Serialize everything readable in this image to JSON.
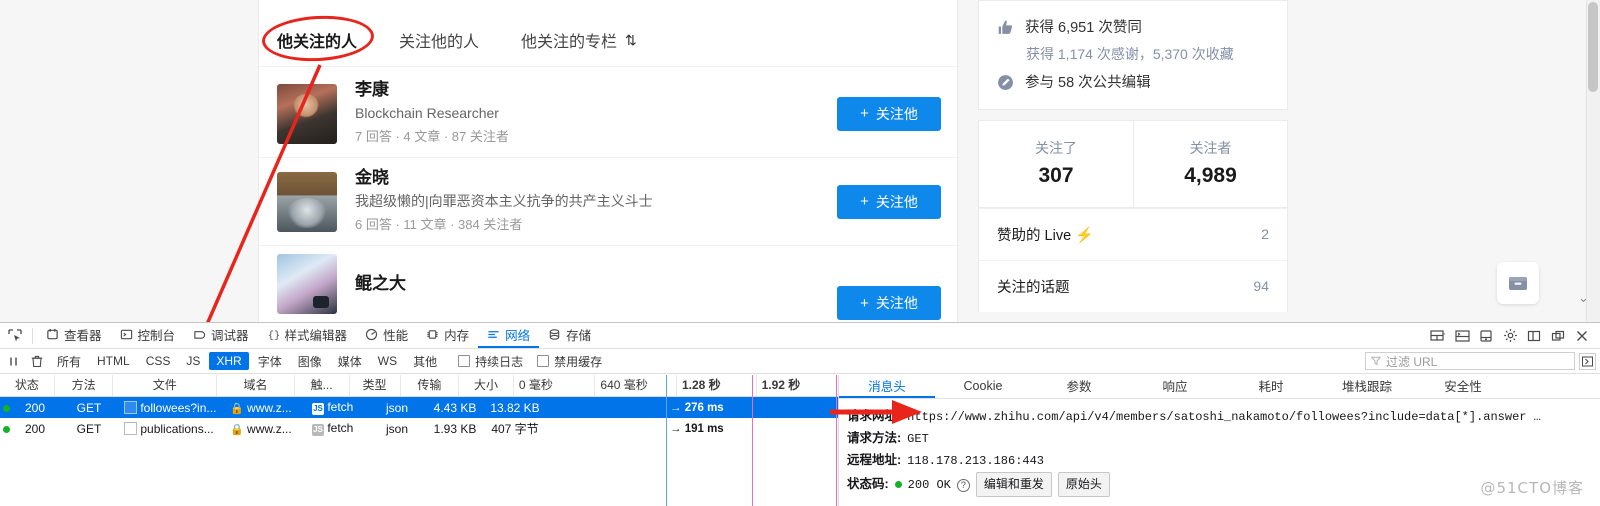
{
  "page": {
    "tabs": [
      {
        "label": "他关注的人",
        "active": true
      },
      {
        "label": "关注他的人",
        "active": false
      },
      {
        "label": "他关注的专栏",
        "active": false
      }
    ],
    "sort_glyph": "⇅",
    "users": [
      {
        "name": "李康",
        "bio": "Blockchain Researcher",
        "meta": "7 回答 · 4 文章 · 87 关注者",
        "follow_label": "关注他",
        "plus": "+"
      },
      {
        "name": "金晓",
        "bio": "我超级懒的|向罪恶资本主义抗争的共产主义斗士",
        "meta": "6 回答 · 11 文章 · 384 关注者",
        "follow_label": "关注他",
        "plus": "+"
      },
      {
        "name": "鲲之大",
        "bio": "",
        "meta": "",
        "follow_label": "关注他",
        "plus": "+"
      }
    ],
    "sidebar": {
      "votes_text": "获得 6,951 次赞同",
      "thanks_text": "获得 1,174 次感谢，5,370 次收藏",
      "edits_text": "参与 58 次公共编辑",
      "counts": [
        {
          "label": "关注了",
          "value": "307"
        },
        {
          "label": "关注者",
          "value": "4,989"
        }
      ],
      "rows": [
        {
          "label": "赞助的 Live",
          "value": "2",
          "bolt": "⚡"
        },
        {
          "label": "关注的话题",
          "value": "94",
          "bolt": ""
        }
      ]
    }
  },
  "devtools": {
    "toolbar_tabs": [
      {
        "label": "查看器",
        "active": false
      },
      {
        "label": "控制台",
        "active": false
      },
      {
        "label": "调试器",
        "active": false
      },
      {
        "label": "样式编辑器",
        "active": false
      },
      {
        "label": "性能",
        "active": false
      },
      {
        "label": "内存",
        "active": false
      },
      {
        "label": "网络",
        "active": true
      },
      {
        "label": "存储",
        "active": false
      }
    ],
    "filters": [
      {
        "label": "所有",
        "on": false
      },
      {
        "label": "HTML",
        "on": false
      },
      {
        "label": "CSS",
        "on": false
      },
      {
        "label": "JS",
        "on": false
      },
      {
        "label": "XHR",
        "on": true
      },
      {
        "label": "字体",
        "on": false
      },
      {
        "label": "图像",
        "on": false
      },
      {
        "label": "媒体",
        "on": false
      },
      {
        "label": "WS",
        "on": false
      },
      {
        "label": "其他",
        "on": false
      }
    ],
    "checkboxes": [
      {
        "label": "持续日志",
        "checked": false
      },
      {
        "label": "禁用缓存",
        "checked": false
      }
    ],
    "filter_url_placeholder": "过滤 URL",
    "filter_icon": "funnel-icon",
    "columns": [
      "状态",
      "方法",
      "文件",
      "域名",
      "触...",
      "类型",
      "传输",
      "大小"
    ],
    "timeline_ticks": [
      "0 毫秒",
      "640 毫秒",
      "1.28 秒",
      "1.92 秒"
    ],
    "rows": [
      {
        "status": "200",
        "method": "GET",
        "file": "followees?in...",
        "domain": "www.z...",
        "cause": "fetch",
        "type": "json",
        "transferred": "4.43 KB",
        "size": "13.82 KB",
        "timing": "→ 276 ms",
        "selected": true
      },
      {
        "status": "200",
        "method": "GET",
        "file": "publications...",
        "domain": "www.z...",
        "cause": "fetch",
        "type": "json",
        "transferred": "1.93 KB",
        "size": "407 字节",
        "timing": "→ 191 ms",
        "selected": false
      }
    ],
    "detail_tabs": [
      {
        "label": "消息头",
        "active": true
      },
      {
        "label": "Cookie",
        "active": false
      },
      {
        "label": "参数",
        "active": false
      },
      {
        "label": "响应",
        "active": false
      },
      {
        "label": "耗时",
        "active": false
      },
      {
        "label": "堆栈跟踪",
        "active": false
      },
      {
        "label": "安全性",
        "active": false
      }
    ],
    "detail": {
      "url_key": "请求网址:",
      "url_value": "https://www.zhihu.com/api/v4/members/satoshi_nakamoto/followees?include=data[*].answer …",
      "method_key": "请求方法:",
      "method_value": "GET",
      "remote_key": "远程地址:",
      "remote_value": "118.178.213.186:443",
      "status_key": "状态码:",
      "status_value": "200 OK",
      "btn_resend": "编辑和重发",
      "btn_raw": "原始头"
    }
  },
  "watermark": "@51CTO博客",
  "colors": {
    "accent_blue": "#0f88eb",
    "devtools_blue": "#0074e8",
    "annotation_red": "#e8251c",
    "status_green": "#12b324"
  }
}
